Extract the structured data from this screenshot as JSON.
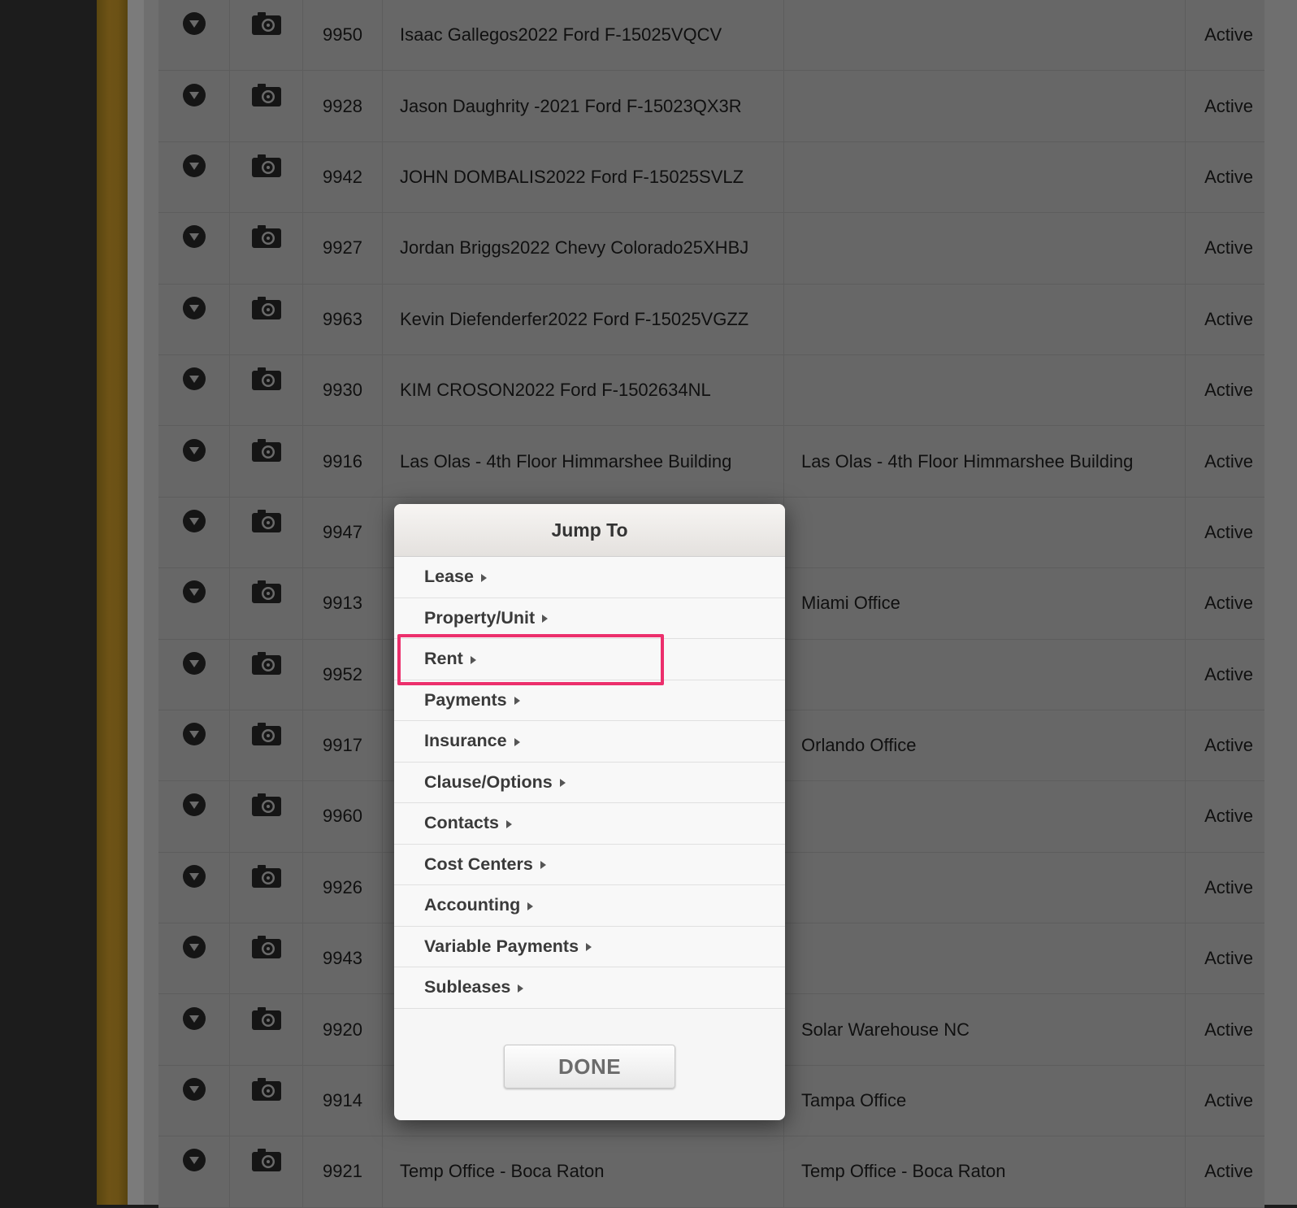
{
  "colors": {
    "accent_highlight": "#ec2f6c",
    "table_bg": "#676767",
    "sidebar_gold": "#6b5115"
  },
  "table": {
    "rows": [
      {
        "id": "9950",
        "name": "Isaac Gallegos2022 Ford F-15025VQCV",
        "location": "",
        "status": "Active"
      },
      {
        "id": "9928",
        "name": "Jason Daughrity -2021 Ford F-15023QX3R",
        "location": "",
        "status": "Active"
      },
      {
        "id": "9942",
        "name": "JOHN DOMBALIS2022 Ford F-15025SVLZ",
        "location": "",
        "status": "Active"
      },
      {
        "id": "9927",
        "name": "Jordan Briggs2022 Chevy Colorado25XHBJ",
        "location": "",
        "status": "Active"
      },
      {
        "id": "9963",
        "name": "Kevin Diefenderfer2022 Ford F-15025VGZZ",
        "location": "",
        "status": "Active"
      },
      {
        "id": "9930",
        "name": "KIM CROSON2022 Ford F-1502634NL",
        "location": "",
        "status": "Active"
      },
      {
        "id": "9916",
        "name": "Las Olas - 4th Floor Himmarshee Building",
        "location": "Las Olas - 4th Floor Himmarshee Building",
        "status": "Active"
      },
      {
        "id": "9947",
        "name": "",
        "location": "",
        "status": "Active"
      },
      {
        "id": "9913",
        "name": "",
        "location": "Miami Office",
        "status": "Active"
      },
      {
        "id": "9952",
        "name": "",
        "location": "",
        "status": "Active"
      },
      {
        "id": "9917",
        "name": "",
        "location": "Orlando Office",
        "status": "Active"
      },
      {
        "id": "9960",
        "name": "",
        "location": "",
        "status": "Active"
      },
      {
        "id": "9926",
        "name": "",
        "location": "",
        "status": "Active"
      },
      {
        "id": "9943",
        "name": "",
        "location": "",
        "status": "Active"
      },
      {
        "id": "9920",
        "name": "",
        "location": "Solar Warehouse NC",
        "status": "Active"
      },
      {
        "id": "9914",
        "name": "",
        "location": "Tampa Office",
        "status": "Active"
      },
      {
        "id": "9921",
        "name": "Temp Office - Boca Raton",
        "location": "Temp Office - Boca Raton",
        "status": "Active"
      }
    ],
    "icons": {
      "expand": "chevron-down-circle-icon",
      "photo": "camera-icon"
    }
  },
  "modal": {
    "title": "Jump To",
    "items": [
      {
        "label": "Lease"
      },
      {
        "label": "Property/Unit"
      },
      {
        "label": "Rent"
      },
      {
        "label": "Payments"
      },
      {
        "label": "Insurance"
      },
      {
        "label": "Clause/Options"
      },
      {
        "label": "Contacts"
      },
      {
        "label": "Cost Centers"
      },
      {
        "label": "Accounting"
      },
      {
        "label": "Variable Payments"
      },
      {
        "label": "Subleases"
      }
    ],
    "highlighted_item": "Rent",
    "done_label": "DONE"
  }
}
